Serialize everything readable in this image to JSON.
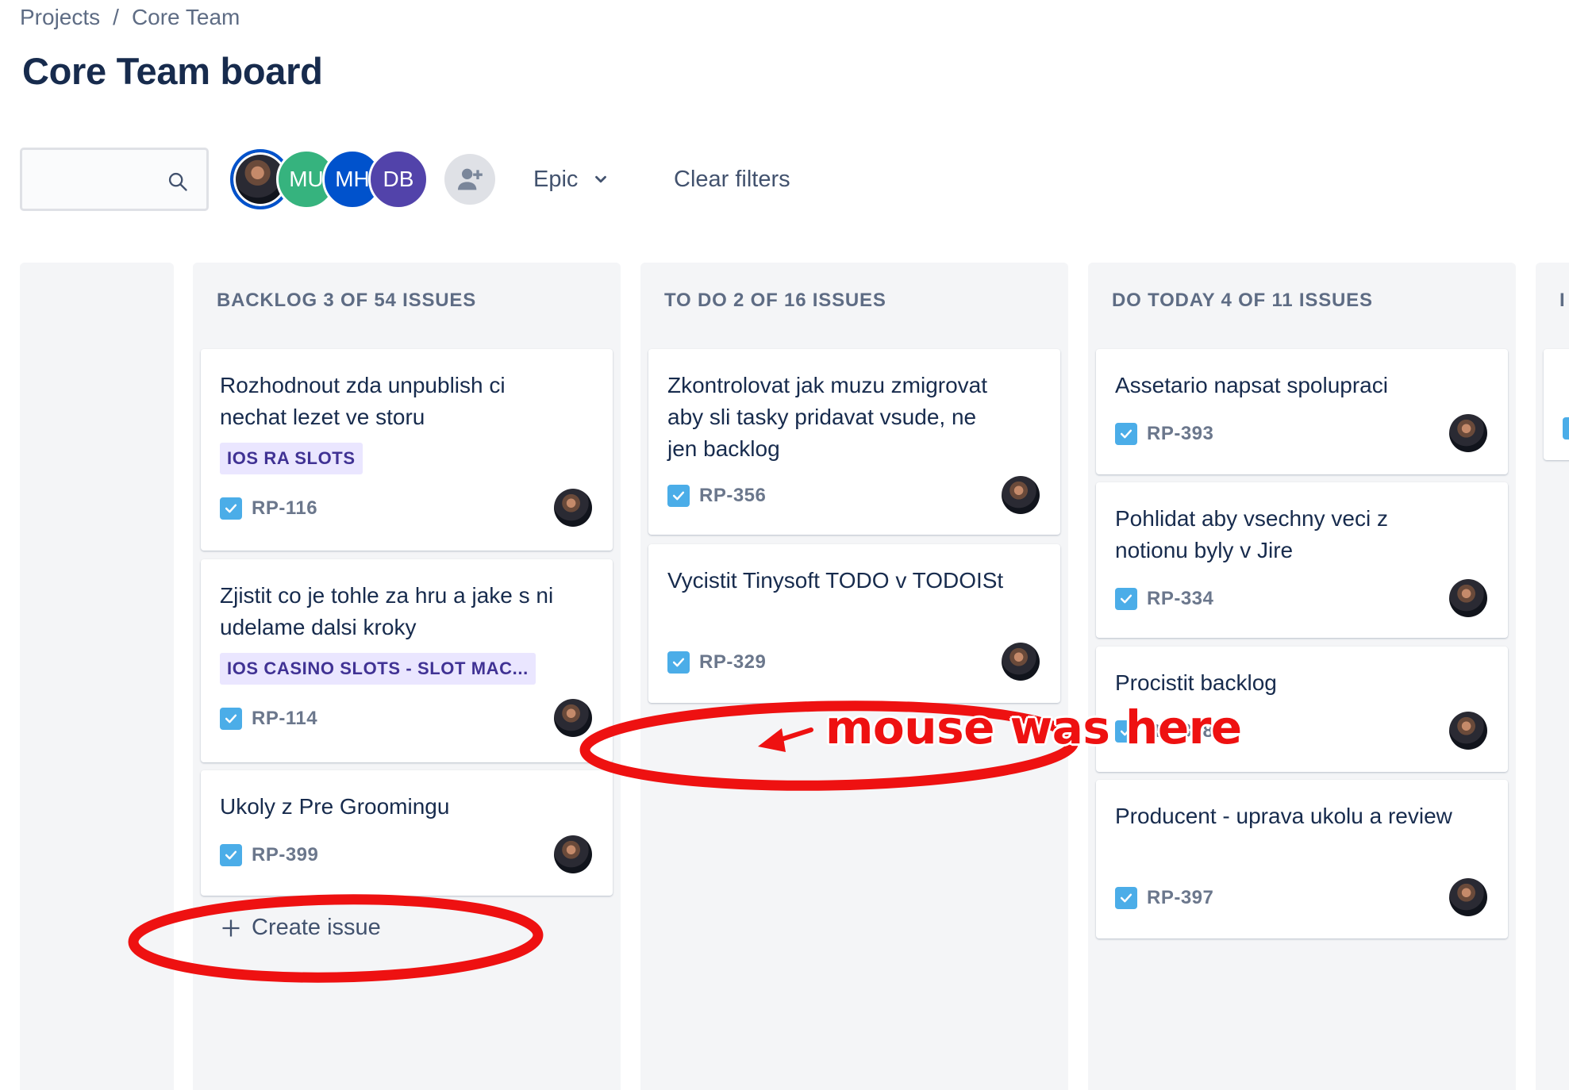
{
  "breadcrumb": {
    "projects": "Projects",
    "separator": "/",
    "current": "Core Team"
  },
  "page_title": "Core Team board",
  "toolbar": {
    "search_placeholder": "",
    "avatars": [
      {
        "initials": "",
        "kind": "photo"
      },
      {
        "initials": "MU",
        "color": "#36b37e"
      },
      {
        "initials": "MH",
        "color": "#0052cc"
      },
      {
        "initials": "DB",
        "color": "#5243aa"
      }
    ],
    "add_person_icon": "add-person-icon",
    "epic_label": "Epic",
    "clear_filters_label": "Clear filters"
  },
  "columns": {
    "left_partial": {
      "header": ""
    },
    "backlog": {
      "header": "BACKLOG 3 OF 54 ISSUES",
      "cards": [
        {
          "title": "Rozhodnout zda unpublish ci nechat lezet ve storu",
          "epic": "IOS RA SLOTS",
          "key": "RP-116"
        },
        {
          "title": "Zjistit co je tohle za hru a jake s ni udelame dalsi kroky",
          "epic": "IOS CASINO SLOTS - SLOT MAC...",
          "key": "RP-114"
        },
        {
          "title": "Ukoly z Pre Groomingu",
          "epic": "",
          "key": "RP-399"
        }
      ],
      "create_issue": "Create issue"
    },
    "todo": {
      "header": "TO DO 2 OF 16 ISSUES",
      "cards": [
        {
          "title": "Zkontrolovat jak muzu zmigrovat aby sli tasky pridavat vsude, ne jen backlog",
          "key": "RP-356"
        },
        {
          "title": "Vycistit Tinysoft TODO v TODOISt",
          "key": "RP-329"
        }
      ]
    },
    "today": {
      "header": "DO TODAY 4 OF 11 ISSUES",
      "cards": [
        {
          "title": "Assetario napsat spolupraci",
          "key": "RP-393"
        },
        {
          "title": "Pohlidat aby vsechny veci z notionu byly v Jire",
          "key": "RP-334"
        },
        {
          "title": "Procistit backlog",
          "key": "RP-328"
        },
        {
          "title": "Producent - uprava ukolu a review",
          "key": "RP-397"
        }
      ]
    },
    "right_partial": {
      "header": "I"
    }
  },
  "annotation": {
    "text": "mouse was here",
    "color": "#ee1111"
  }
}
